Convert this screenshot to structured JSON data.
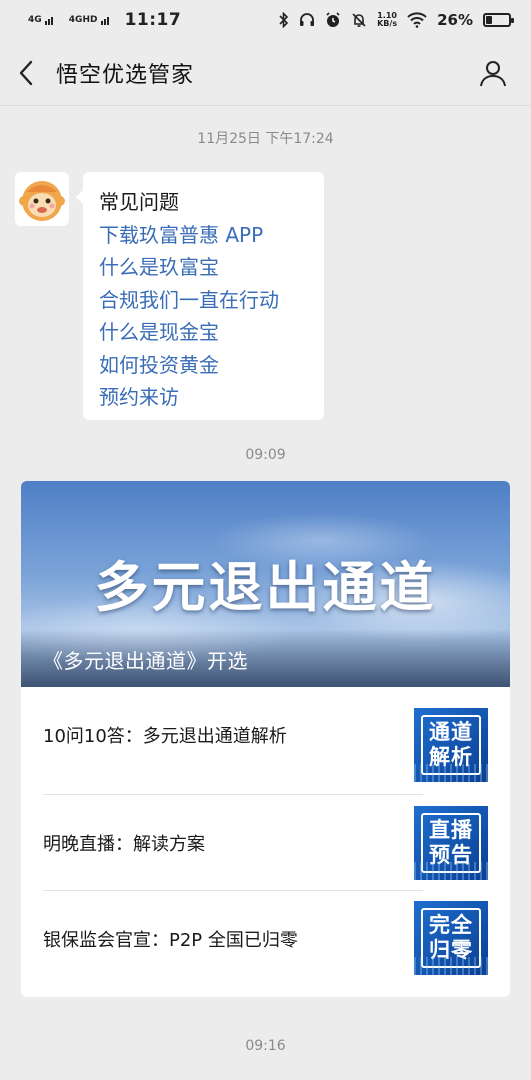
{
  "status_bar": {
    "network1": "4G",
    "network2": "4GHD",
    "time": "11:17",
    "speed_value": "1.10",
    "speed_unit": "KB/s",
    "battery_percent": "26%",
    "battery_level": 0.26,
    "icons": [
      "bluetooth-icon",
      "headphones-icon",
      "alarm-icon",
      "mute-icon",
      "wifi-icon",
      "battery-icon"
    ]
  },
  "header": {
    "title": "悟空优选管家",
    "back_icon": "chevron-left-icon",
    "profile_icon": "person-icon"
  },
  "timestamps": {
    "first": "11月25日 下午17:24",
    "second": "09:09",
    "third": "09:16"
  },
  "faq_message": {
    "title": "常见问题",
    "links": [
      "下载玖富普惠 APP",
      "什么是玖富宝",
      "合规我们一直在行动",
      "什么是现金宝",
      "如何投资黄金",
      "预约来访"
    ]
  },
  "article_card": {
    "cover_text": "多元退出通道",
    "cover_caption": "《多元退出通道》开选",
    "items": [
      {
        "title": "10问10答：多元退出通道解析",
        "thumb_line1": "通道",
        "thumb_line2": "解析"
      },
      {
        "title": "明晚直播：解读方案",
        "thumb_line1": "直播",
        "thumb_line2": "预告"
      },
      {
        "title": "银保监会官宣：P2P 全国已归零",
        "thumb_line1": "完全",
        "thumb_line2": "归零"
      }
    ]
  },
  "colors": {
    "background": "#ececec",
    "link": "#3a6db8",
    "thumb_blue": "#1e6fd0"
  }
}
